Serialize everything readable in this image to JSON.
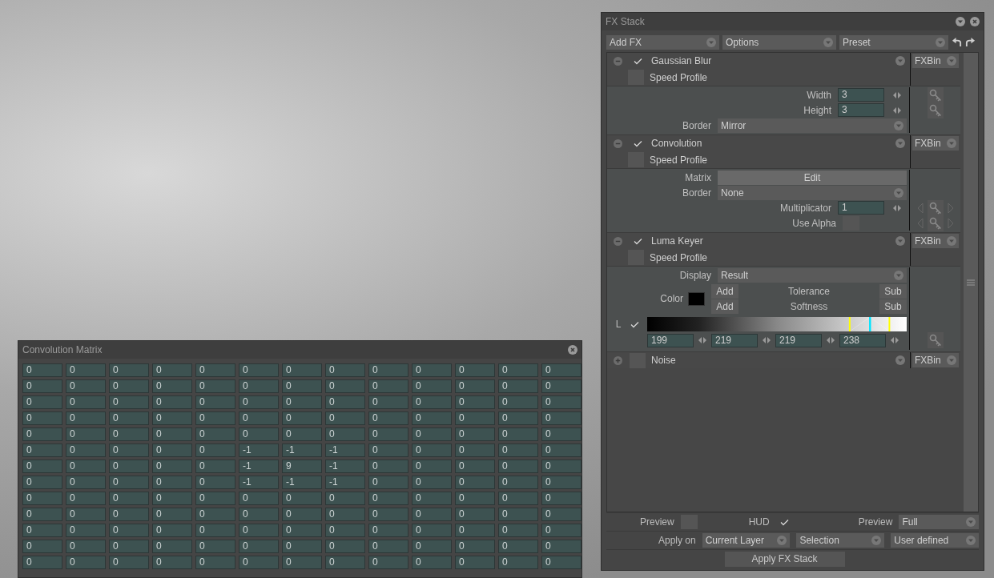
{
  "fx_stack": {
    "title": "FX Stack",
    "toolbar": [
      {
        "value": "Add FX"
      },
      {
        "value": "Options"
      },
      {
        "value": "Preset"
      }
    ],
    "effects": [
      {
        "name": "Gaussian Blur",
        "enabled": true,
        "expanded": true,
        "speed_profile": {
          "label": "Speed Profile",
          "checked": false
        },
        "bin": "FXBin",
        "params": [
          {
            "kind": "number",
            "label": "Width",
            "value": "3",
            "keyframe": true,
            "nav": false
          },
          {
            "kind": "number",
            "label": "Height",
            "value": "3",
            "keyframe": true,
            "nav": false
          },
          {
            "kind": "dropdown",
            "label": "Border",
            "value": "Mirror"
          }
        ]
      },
      {
        "name": "Convolution",
        "enabled": true,
        "expanded": true,
        "speed_profile": {
          "label": "Speed Profile",
          "checked": false
        },
        "bin": "FXBin",
        "params": [
          {
            "kind": "button",
            "label": "Matrix",
            "text": "Edit"
          },
          {
            "kind": "dropdown",
            "label": "Border",
            "value": "None"
          },
          {
            "kind": "number",
            "label": "Multiplicator",
            "value": "1",
            "keyframe": true,
            "nav": true
          },
          {
            "kind": "checkbox",
            "label": "Use Alpha",
            "checked": false,
            "keyframe": true,
            "nav": true
          }
        ]
      },
      {
        "name": "Luma Keyer",
        "enabled": true,
        "expanded": true,
        "speed_profile": {
          "label": "Speed Profile",
          "checked": false
        },
        "bin": "FXBin",
        "params": [
          {
            "kind": "dropdown",
            "label": "Display",
            "value": "Result"
          },
          {
            "kind": "color_adjust",
            "label": "Color",
            "color": "#000000",
            "adjusters": [
              {
                "add": "Add",
                "name": "Tolerance",
                "sub": "Sub"
              },
              {
                "add": "Add",
                "name": "Softness",
                "sub": "Sub"
              }
            ]
          },
          {
            "kind": "range",
            "label": "L",
            "checked": true,
            "values": [
              "199",
              "219",
              "219",
              "238"
            ],
            "keyframe": true
          }
        ]
      },
      {
        "name": "Noise",
        "enabled": false,
        "expanded": false,
        "bin": "FXBin"
      }
    ],
    "preview": {
      "label": "Preview",
      "checked": false
    },
    "hud": {
      "label": "HUD",
      "checked": true
    },
    "preview_mode": {
      "label": "Preview",
      "value": "Full"
    },
    "apply_on": {
      "label": "Apply on",
      "options": [
        "Current Layer",
        "Selection",
        "User defined"
      ]
    },
    "apply_button": "Apply FX Stack"
  },
  "matrix": {
    "title": "Convolution Matrix",
    "rows": [
      [
        "0",
        "0",
        "0",
        "0",
        "0",
        "0",
        "0",
        "0",
        "0",
        "0",
        "0",
        "0",
        "0"
      ],
      [
        "0",
        "0",
        "0",
        "0",
        "0",
        "0",
        "0",
        "0",
        "0",
        "0",
        "0",
        "0",
        "0"
      ],
      [
        "0",
        "0",
        "0",
        "0",
        "0",
        "0",
        "0",
        "0",
        "0",
        "0",
        "0",
        "0",
        "0"
      ],
      [
        "0",
        "0",
        "0",
        "0",
        "0",
        "0",
        "0",
        "0",
        "0",
        "0",
        "0",
        "0",
        "0"
      ],
      [
        "0",
        "0",
        "0",
        "0",
        "0",
        "0",
        "0",
        "0",
        "0",
        "0",
        "0",
        "0",
        "0"
      ],
      [
        "0",
        "0",
        "0",
        "0",
        "0",
        "-1",
        "-1",
        "-1",
        "0",
        "0",
        "0",
        "0",
        "0"
      ],
      [
        "0",
        "0",
        "0",
        "0",
        "0",
        "-1",
        "9",
        "-1",
        "0",
        "0",
        "0",
        "0",
        "0"
      ],
      [
        "0",
        "0",
        "0",
        "0",
        "0",
        "-1",
        "-1",
        "-1",
        "0",
        "0",
        "0",
        "0",
        "0"
      ],
      [
        "0",
        "0",
        "0",
        "0",
        "0",
        "0",
        "0",
        "0",
        "0",
        "0",
        "0",
        "0",
        "0"
      ],
      [
        "0",
        "0",
        "0",
        "0",
        "0",
        "0",
        "0",
        "0",
        "0",
        "0",
        "0",
        "0",
        "0"
      ],
      [
        "0",
        "0",
        "0",
        "0",
        "0",
        "0",
        "0",
        "0",
        "0",
        "0",
        "0",
        "0",
        "0"
      ],
      [
        "0",
        "0",
        "0",
        "0",
        "0",
        "0",
        "0",
        "0",
        "0",
        "0",
        "0",
        "0",
        "0"
      ],
      [
        "0",
        "0",
        "0",
        "0",
        "0",
        "0",
        "0",
        "0",
        "0",
        "0",
        "0",
        "0",
        "0"
      ]
    ]
  }
}
